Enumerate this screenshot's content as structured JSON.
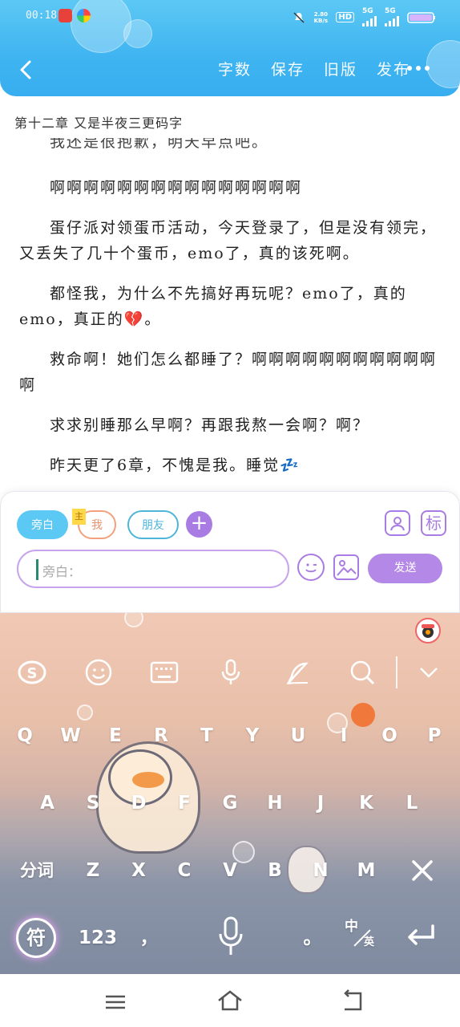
{
  "status": {
    "time": "00:18",
    "speed": "2.80 KB/s",
    "hd": "HD",
    "net1": "5G",
    "net2": "5G"
  },
  "nav": {
    "word_count": "字数",
    "save": "保存",
    "history": "旧版",
    "publish": "发布"
  },
  "chapter_title": "第十二章  又是半夜三更码字",
  "article": {
    "cut_line": "我还是很抱歉，明天早点吧。",
    "paragraphs": [
      "啊啊啊啊啊啊啊啊啊啊啊啊啊啊啊",
      "蛋仔派对领蛋币活动，今天登录了，但是没有领完，又丢失了几十个蛋币，emo了，真的该死啊。",
      "都怪我，为什么不先搞好再玩呢？emo了，真的emo，真正的💔。",
      "救命啊！她们怎么都睡了？啊啊啊啊啊啊啊啊啊啊啊啊",
      "求求别睡那么早啊？再跟我熬一会啊？啊？",
      "昨天更了6章，不愧是我。睡觉💤"
    ]
  },
  "comment": {
    "tabs": [
      "旁白",
      "我",
      "朋友"
    ],
    "tag": "主",
    "placeholder": "旁白：",
    "send": "发送",
    "right_icon": "标"
  },
  "keyboard": {
    "row1": [
      "Q",
      "W",
      "E",
      "R",
      "T",
      "Y",
      "U",
      "I",
      "O",
      "P"
    ],
    "row2": [
      "A",
      "S",
      "D",
      "F",
      "G",
      "H",
      "J",
      "K",
      "L"
    ],
    "row3": [
      "Z",
      "X",
      "C",
      "V",
      "B",
      "N",
      "M"
    ],
    "fenci": "分词",
    "fu": "符",
    "num": "123",
    "comma": "，",
    "period": "。",
    "lang_top": "中",
    "lang_bottom": "英"
  },
  "colors": {
    "header": "#3fb4f1",
    "accent_purple": "#a97ce4",
    "send": "#b488e6"
  }
}
